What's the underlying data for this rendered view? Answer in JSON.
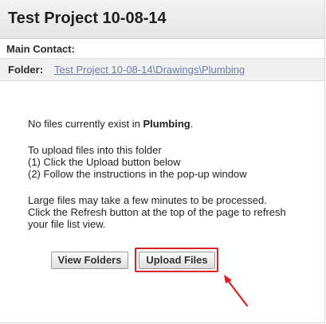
{
  "header": {
    "title": "Test Project 10-08-14"
  },
  "contact": {
    "label": "Main Contact:"
  },
  "folder": {
    "label": "Folder:",
    "path_link": "Test Project 10-08-14\\Drawings\\Plumbing"
  },
  "message": {
    "no_files_prefix": "No files currently exist in ",
    "folder_name": "Plumbing",
    "no_files_suffix": ".",
    "upload_intro": "To upload files into this folder",
    "step1": "(1) Click the Upload button below",
    "step2": "(2) Follow the instructions in the pop-up window",
    "large_files_note": "Large files may take a few minutes to be processed. Click the Refresh button at the top of the page to refresh your file list view."
  },
  "buttons": {
    "view_folders": "View Folders",
    "upload_files": "Upload Files"
  },
  "colors": {
    "highlight": "#e02020",
    "link": "#6b7fa8"
  },
  "icons": {
    "annotation": "red-arrow-icon"
  }
}
